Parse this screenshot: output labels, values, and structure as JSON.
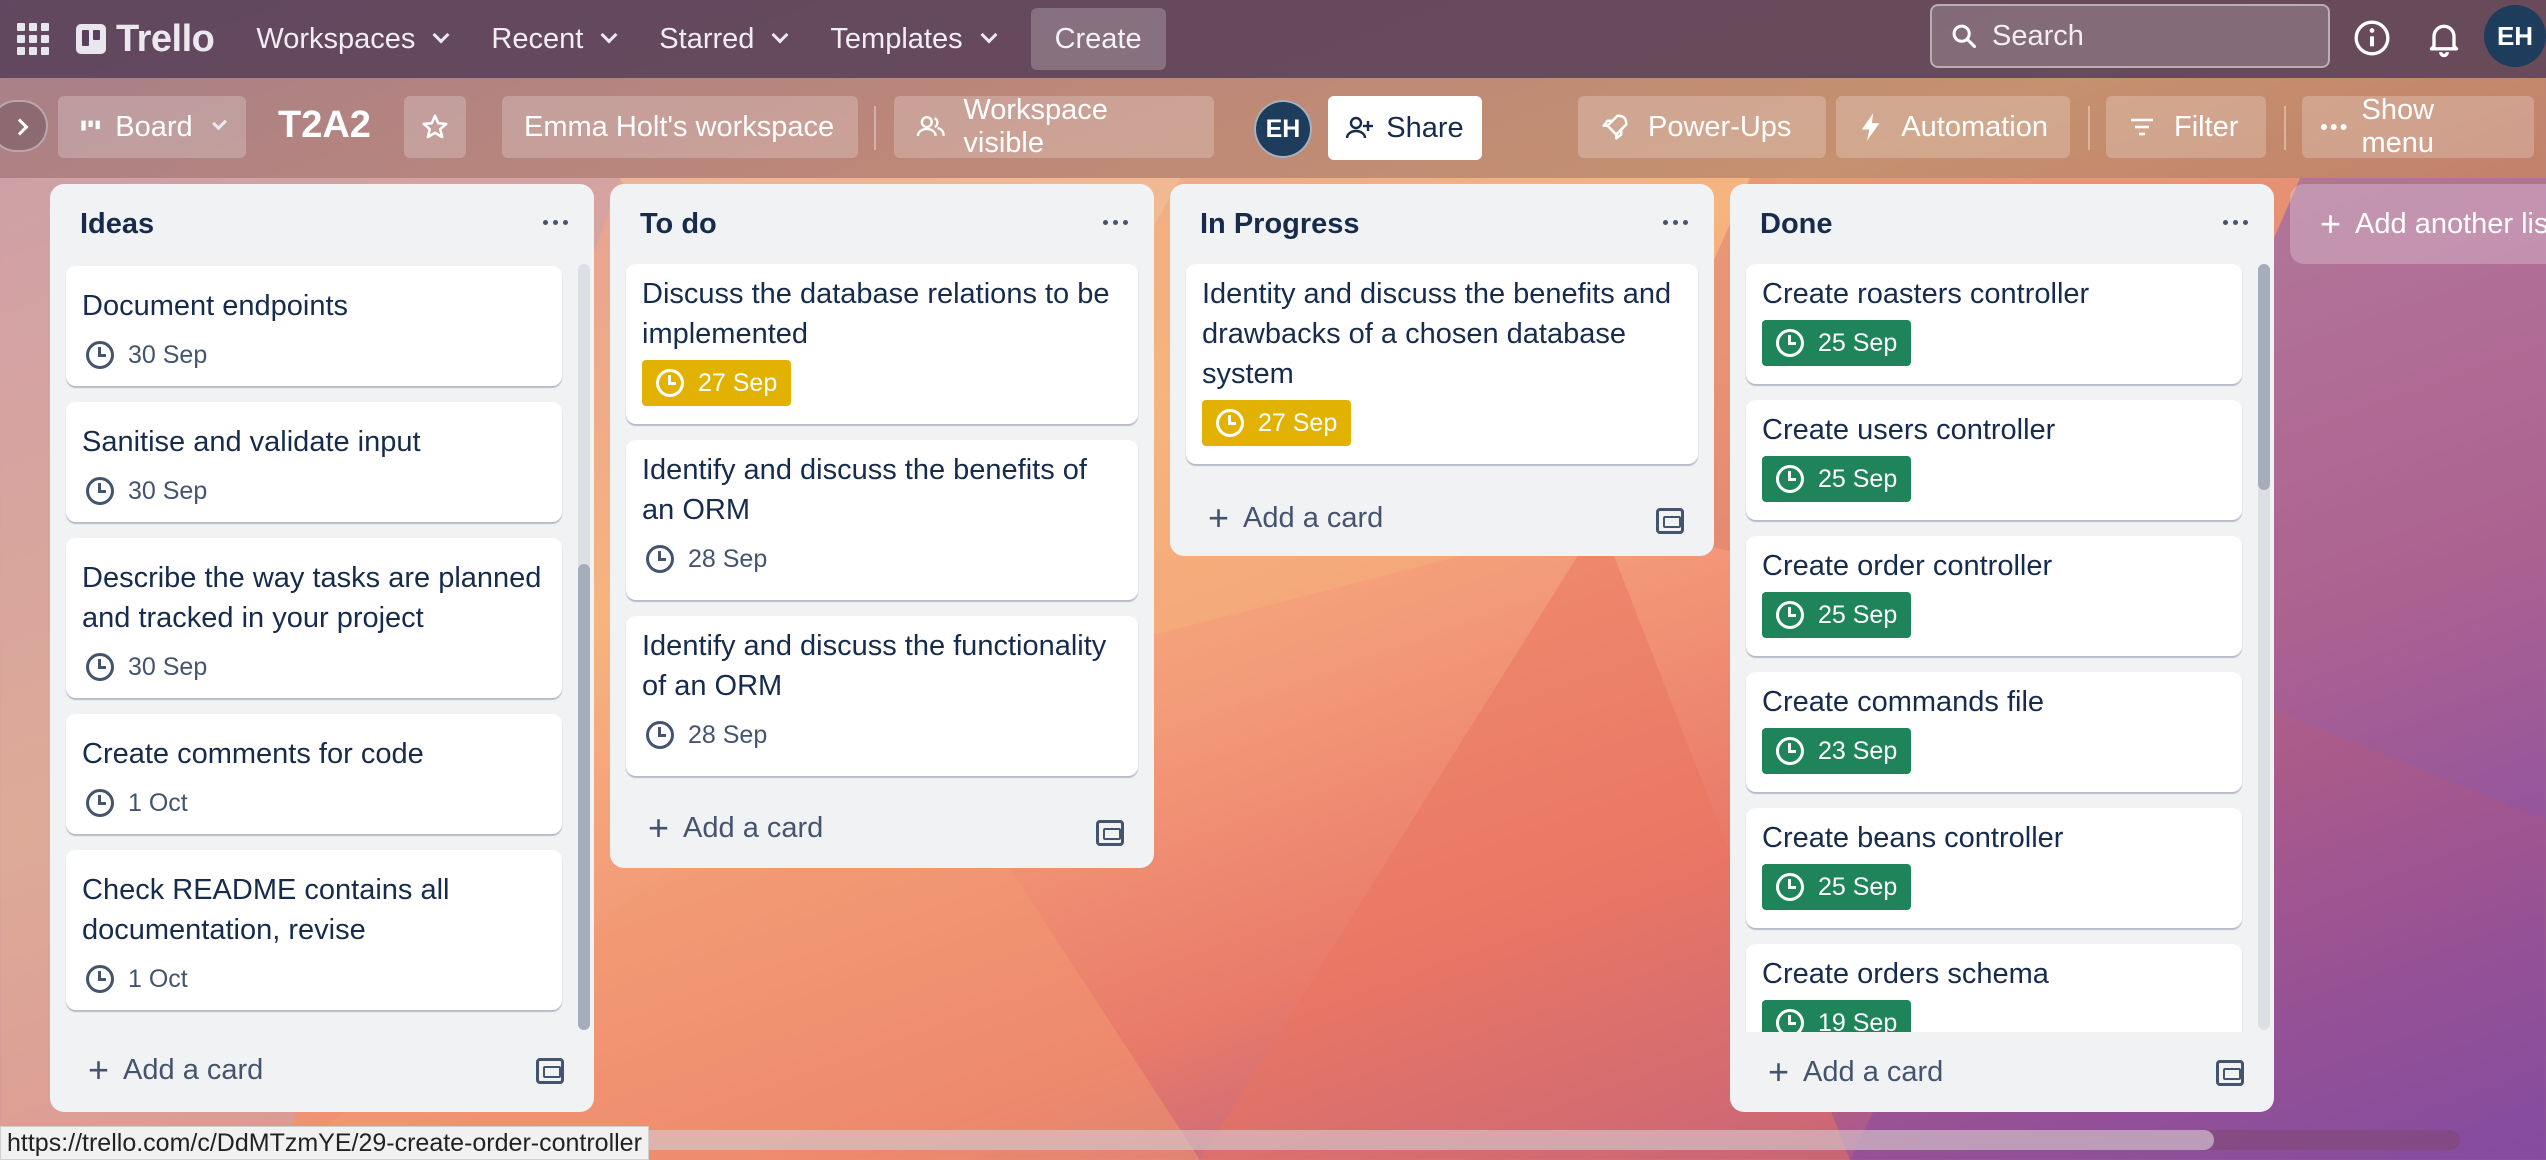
{
  "app": {
    "name": "Trello",
    "nav": [
      "Workspaces",
      "Recent",
      "Starred",
      "Templates"
    ],
    "create_label": "Create",
    "search_placeholder": "Search",
    "user_initials": "EH"
  },
  "board": {
    "view_label": "Board",
    "title": "T2A2",
    "workspace_label": "Emma Holt's workspace",
    "visibility_label": "Workspace visible",
    "member_initials": "EH",
    "share_label": "Share",
    "powerups_label": "Power-Ups",
    "automation_label": "Automation",
    "filter_label": "Filter",
    "show_menu_label": "Show menu",
    "add_list_label": "Add another lis"
  },
  "lists": [
    {
      "title": "Ideas",
      "add_label": "Add a card",
      "cards": [
        {
          "title": "Document endpoints",
          "due": "30 Sep",
          "due_style": "plain"
        },
        {
          "title": "Sanitise and validate input",
          "due": "30 Sep",
          "due_style": "plain"
        },
        {
          "title": "Describe the way tasks are planned and tracked in your project",
          "due": "30 Sep",
          "due_style": "plain"
        },
        {
          "title": "Create comments for code",
          "due": "1 Oct",
          "due_style": "plain"
        },
        {
          "title": "Check README contains all documentation, revise",
          "due": "1 Oct",
          "due_style": "plain"
        }
      ]
    },
    {
      "title": "To do",
      "add_label": "Add a card",
      "cards": [
        {
          "title": "Discuss the database relations to be implemented",
          "due": "27 Sep",
          "due_style": "yellow"
        },
        {
          "title": "Identify and discuss the benefits of an ORM",
          "due": "28 Sep",
          "due_style": "plain"
        },
        {
          "title": "Identify and discuss the functionality of an ORM",
          "due": "28 Sep",
          "due_style": "plain"
        }
      ]
    },
    {
      "title": "In Progress",
      "add_label": "Add a card",
      "cards": [
        {
          "title": "Identity and discuss the benefits and drawbacks of a chosen database system",
          "due": "27 Sep",
          "due_style": "yellow"
        }
      ]
    },
    {
      "title": "Done",
      "add_label": "Add a card",
      "cards": [
        {
          "title": "Create roasters controller",
          "due": "25 Sep",
          "due_style": "green"
        },
        {
          "title": "Create users controller",
          "due": "25 Sep",
          "due_style": "green"
        },
        {
          "title": "Create order controller",
          "due": "25 Sep",
          "due_style": "green"
        },
        {
          "title": "Create commands file",
          "due": "23 Sep",
          "due_style": "green"
        },
        {
          "title": "Create beans controller",
          "due": "25 Sep",
          "due_style": "green"
        },
        {
          "title": "Create orders schema",
          "due": "19 Sep",
          "due_style": "green"
        }
      ]
    }
  ],
  "status_url": "https://trello.com/c/DdMTzmYE/29-create-order-controller",
  "colors": {
    "header_bg": "#503a54",
    "list_bg": "#f1f2f4",
    "due_yellow": "#e2b203",
    "due_green": "#1f845a",
    "text": "#172b4d"
  }
}
